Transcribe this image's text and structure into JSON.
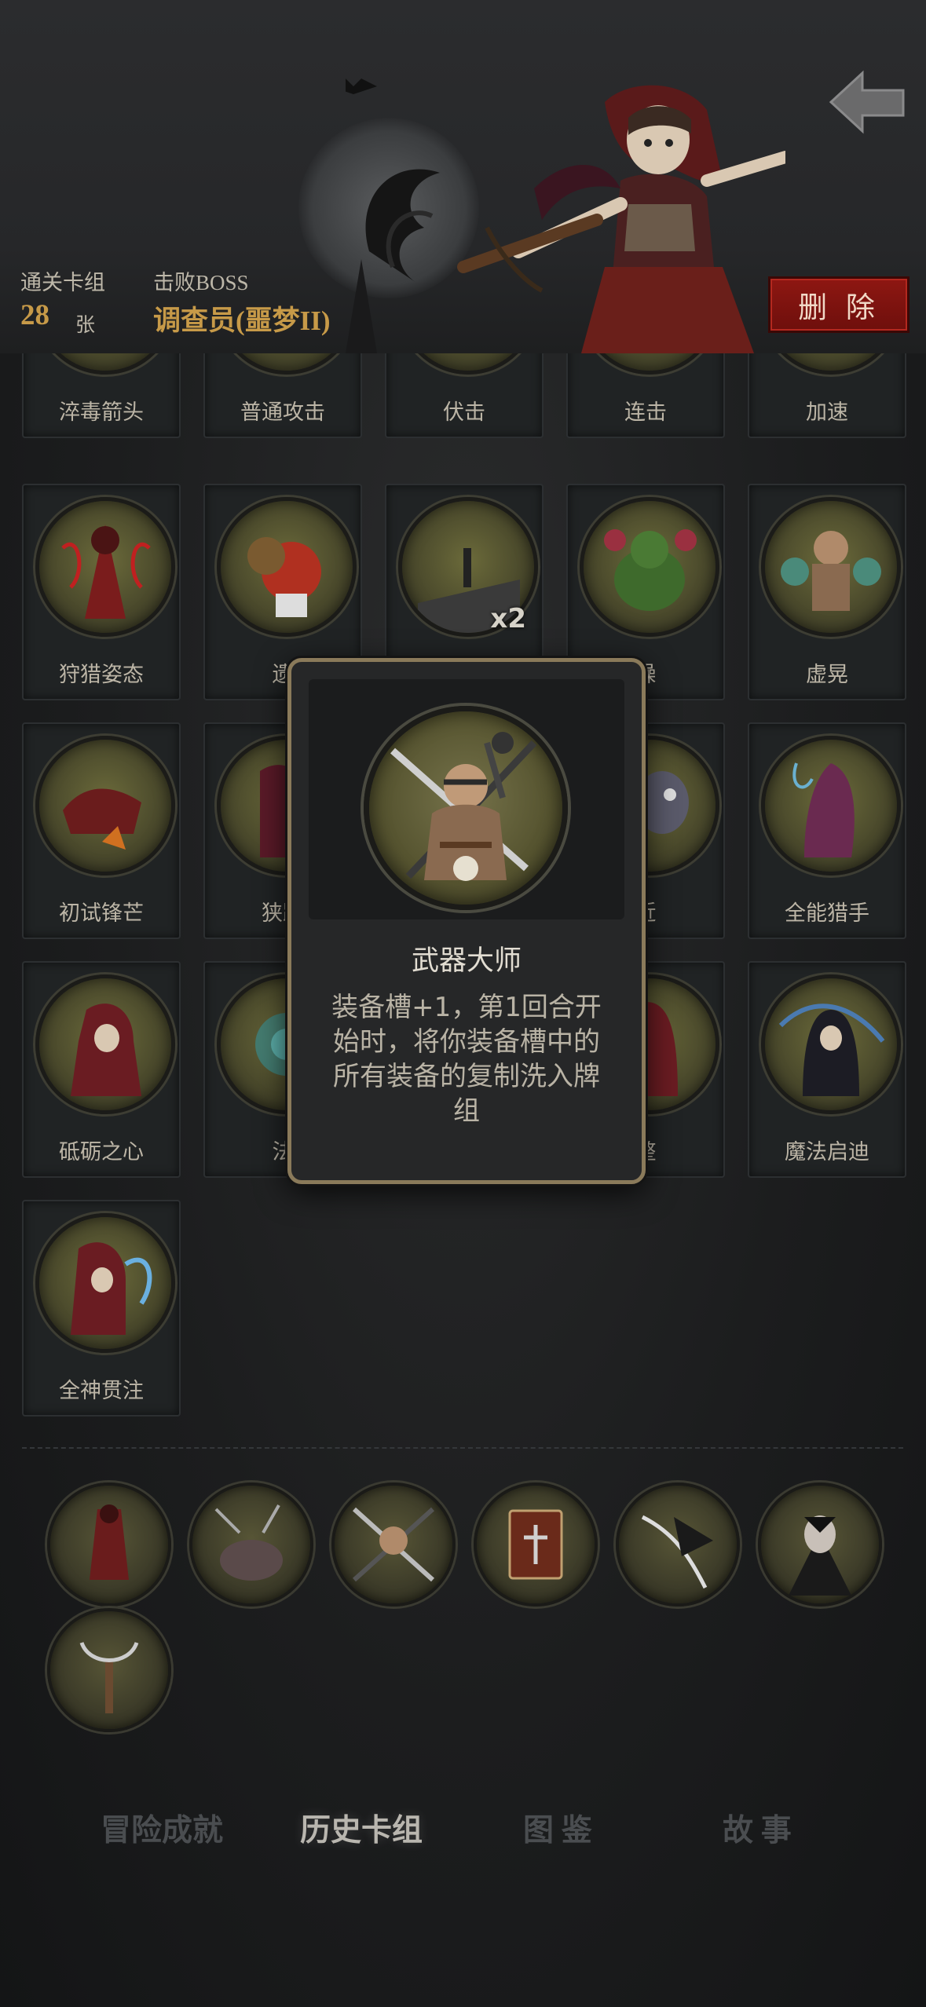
{
  "header": {
    "clear_deck_label": "通关卡组",
    "clear_deck_count": "28",
    "clear_deck_unit": "张",
    "boss_label": "击败BOSS",
    "boss_name": "调查员(噩梦II)",
    "delete_label": "删 除",
    "back_icon": "back-arrow-icon"
  },
  "cards_top_row": [
    {
      "name": "淬毒箭头"
    },
    {
      "name": "普通攻击"
    },
    {
      "name": "伏击"
    },
    {
      "name": "连击"
    },
    {
      "name": "加速"
    }
  ],
  "cards": [
    {
      "name": "狩猎姿态",
      "color": "#8a2020"
    },
    {
      "name": "遗",
      "color": "#b04030"
    },
    {
      "name": "",
      "badge": "x2",
      "color": "#444"
    },
    {
      "name": "躁",
      "color": "#4a6a30"
    },
    {
      "name": "虚晃",
      "color": "#6a6050"
    },
    {
      "name": "初试锋芒",
      "color": "#8a2020"
    },
    {
      "name": "狭路",
      "color": "#6a2030"
    },
    {
      "name": "",
      "color": "#333"
    },
    {
      "name": "近",
      "color": "#505060"
    },
    {
      "name": "全能猎手",
      "color": "#603050"
    },
    {
      "name": "砥砺之心",
      "color": "#6a2025"
    },
    {
      "name": "法",
      "color": "#3a8a8a"
    },
    {
      "name": "",
      "color": "#333"
    },
    {
      "name": "整",
      "color": "#6a2025"
    },
    {
      "name": "魔法启迪",
      "color": "#3a5a8a"
    },
    {
      "name": "全神贯注",
      "color": "#6a2025"
    }
  ],
  "relics": [
    {
      "icon": "hunter-icon"
    },
    {
      "icon": "fallen-beast-icon"
    },
    {
      "icon": "weapon-master-icon"
    },
    {
      "icon": "holy-book-icon"
    },
    {
      "icon": "slash-icon"
    },
    {
      "icon": "vampire-icon"
    },
    {
      "icon": "grappling-hook-icon"
    }
  ],
  "tabs": [
    {
      "label": "冒险成就",
      "active": false
    },
    {
      "label": "历史卡组",
      "active": true
    },
    {
      "label": "图 鉴",
      "active": false
    },
    {
      "label": "故 事",
      "active": false
    }
  ],
  "popup": {
    "title": "武器大师",
    "description": "装备槽+1，第1回合开始时，将你装备槽中的所有装备的复制洗入牌组"
  }
}
